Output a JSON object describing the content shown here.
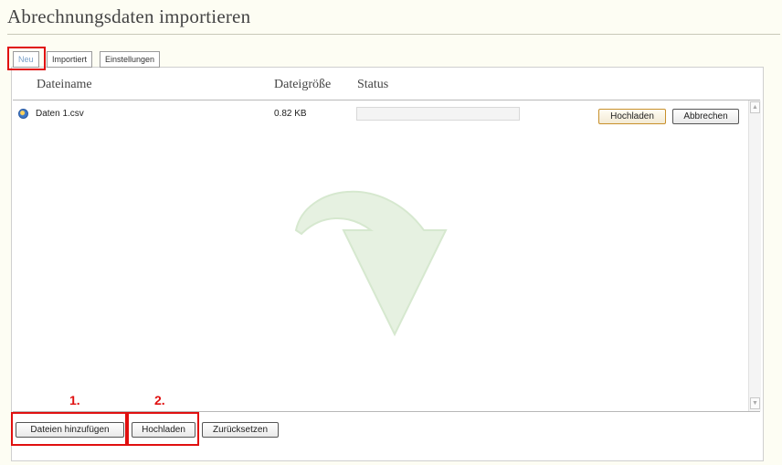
{
  "page": {
    "title": "Abrechnungsdaten importieren"
  },
  "tabs": [
    {
      "label": "Neu",
      "active": true
    },
    {
      "label": "Importiert",
      "active": false
    },
    {
      "label": "Einstellungen",
      "active": false
    }
  ],
  "table": {
    "columns": [
      "Dateiname",
      "Dateigröße",
      "Status"
    ],
    "rows": [
      {
        "icon": "file-queue-icon",
        "name": "Daten 1.csv",
        "size": "0.82 KB",
        "progress": 0,
        "upload_label": "Hochladen",
        "cancel_label": "Abbrechen"
      }
    ]
  },
  "footer": {
    "add_files_label": "Dateien hinzufügen",
    "upload_label": "Hochladen",
    "reset_label": "Zurücksetzen"
  },
  "annotations": {
    "step1": "1.",
    "step2": "2."
  },
  "colors": {
    "accent_red": "#e01010",
    "drop_arrow": "#e4f1df",
    "background": "#fdfdf3"
  }
}
